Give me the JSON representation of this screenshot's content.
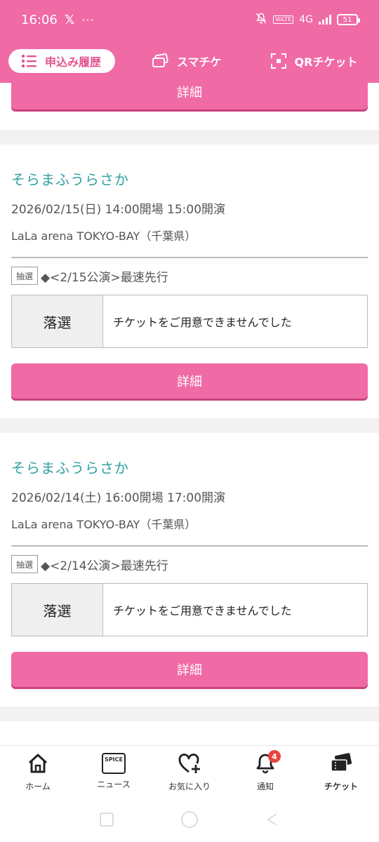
{
  "status_bar": {
    "time": "16:06",
    "x_icon": "x-logo-icon",
    "dots": "···",
    "network": "4G",
    "volte": "VoLTE",
    "battery": "51"
  },
  "top_tabs": [
    {
      "label": "申込み履歴",
      "icon": "list-icon",
      "active": true
    },
    {
      "label": "スマチケ",
      "icon": "ticket-stack-icon",
      "active": false
    },
    {
      "label": "QRチケット",
      "icon": "qr-scan-icon",
      "active": false
    }
  ],
  "detail_label": "詳細",
  "applications": [
    {
      "artist": "そらまふうらさか",
      "datetime": "2026/02/15(日) 14:00開場 15:00開演",
      "venue": "LaLa arena TOKYO-BAY（千葉県）",
      "lottery_tag": "抽選",
      "lottery_name": "◆<2/15公演>最速先行",
      "result": "落選",
      "message": "チケットをご用意できませんでした"
    },
    {
      "artist": "そらまふうらさか",
      "datetime": "2026/02/14(土) 16:00開場 17:00開演",
      "venue": "LaLa arena TOKYO-BAY（千葉県）",
      "lottery_tag": "抽選",
      "lottery_name": "◆<2/14公演>最速先行",
      "result": "落選",
      "message": "チケットをご用意できませんでした"
    }
  ],
  "bottom_nav": [
    {
      "label": "ホーム",
      "icon": "home-icon"
    },
    {
      "label": "ニュース",
      "icon": "spice-news-icon",
      "icon_text": "SPICE"
    },
    {
      "label": "お気に入り",
      "icon": "heart-plus-icon"
    },
    {
      "label": "通知",
      "icon": "bell-icon",
      "badge": "4"
    },
    {
      "label": "チケット",
      "icon": "tickets-icon",
      "active": true
    }
  ],
  "colors": {
    "brand_pink": "#f06aa6",
    "artist_teal": "#2fa0a0",
    "badge_red": "#e8453c"
  }
}
